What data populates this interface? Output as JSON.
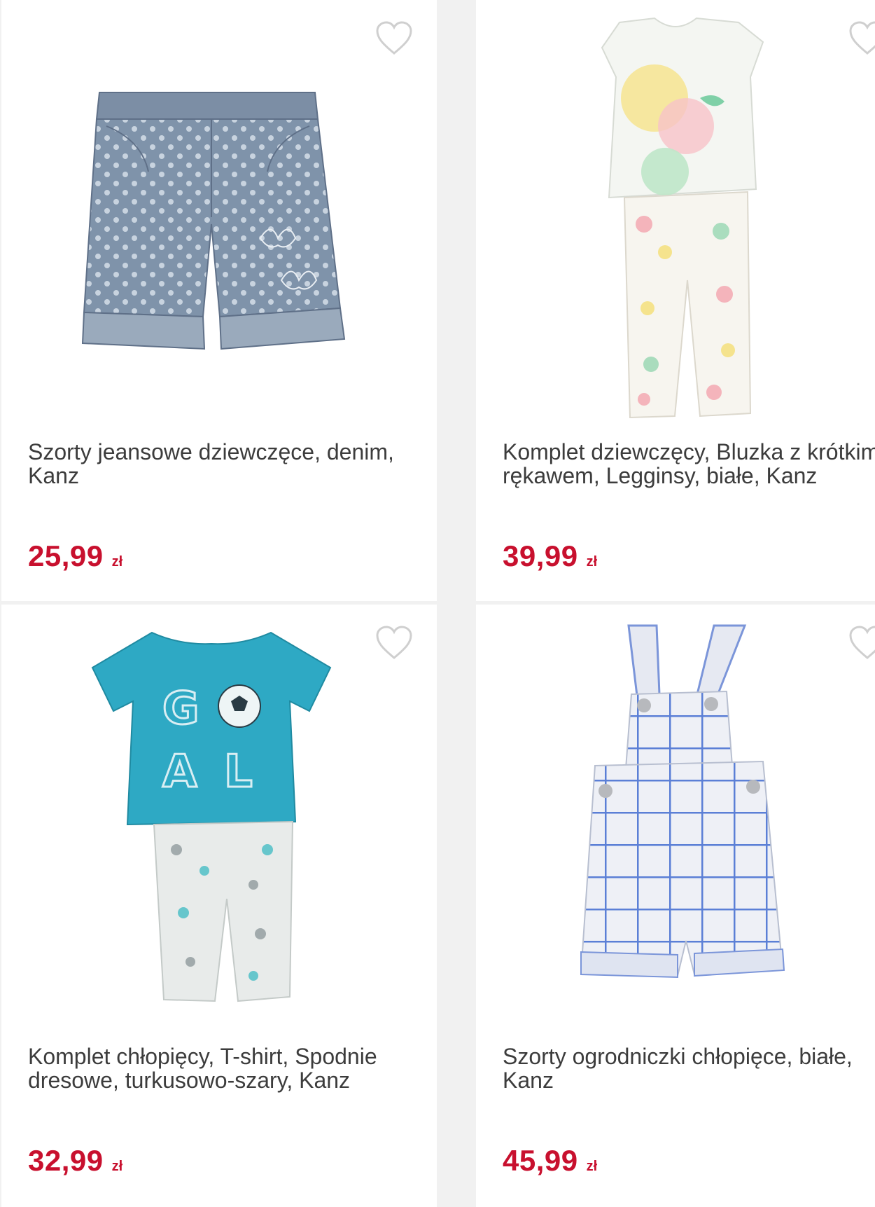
{
  "colors": {
    "price": "#c8102e",
    "title": "#3c3c3c",
    "card_bg": "#ffffff",
    "gap_bg": "#f1f1f1"
  },
  "products": [
    {
      "title": "Szorty jeansowe dziewczęce, denim, Kanz",
      "price": "25,99",
      "currency": "zł",
      "image_icon": "denim-polka-dot-shorts"
    },
    {
      "title": "Komplet dziewczęcy, Bluzka z krótkim rękawem, Legginsy, białe, Kanz",
      "price": "39,99",
      "currency": "zł",
      "image_icon": "floral-blouse-leggings-set"
    },
    {
      "title": "Komplet chłopięcy, T-shirt, Spodnie dresowe, turkusowo-szary, Kanz",
      "price": "32,99",
      "currency": "zł",
      "image_icon": "goal-tshirt-pants-set"
    },
    {
      "title": "Szorty ogrodniczki chłopięce, białe, Kanz",
      "price": "45,99",
      "currency": "zł",
      "image_icon": "checked-dungaree-shorts"
    }
  ],
  "favorite_icon": "heart-outline-icon"
}
